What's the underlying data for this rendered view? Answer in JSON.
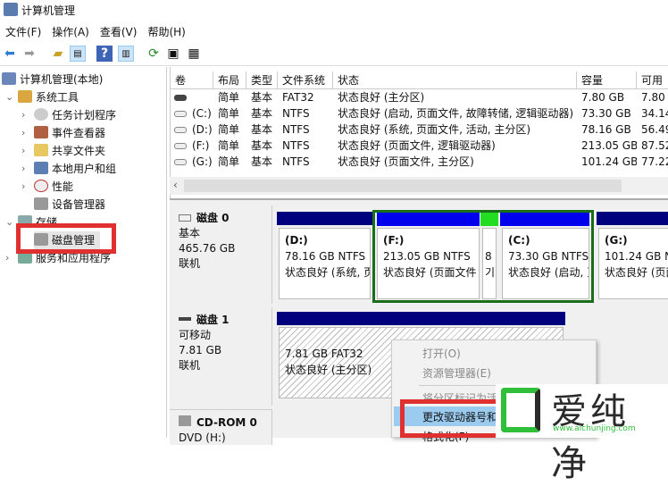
{
  "window": {
    "title": "计算机管理"
  },
  "menu": [
    "文件(F)",
    "操作(A)",
    "查看(V)",
    "帮助(H)"
  ],
  "toolbar": [
    "back-icon",
    "forward-icon",
    "up-folder-icon",
    "show-tree-icon",
    "help-icon",
    "show-action-icon",
    "refresh-icon",
    "properties-icon",
    "export-icon"
  ],
  "tree": {
    "root": "计算机管理(本地)",
    "system_tools": "系统工具",
    "items": [
      "任务计划程序",
      "事件查看器",
      "共享文件夹",
      "本地用户和组",
      "性能",
      "设备管理器"
    ],
    "storage": "存储",
    "disk_mgmt": "磁盘管理",
    "services": "服务和应用程序"
  },
  "table": {
    "headers": [
      "卷",
      "布局",
      "类型",
      "文件系统",
      "状态",
      "容量",
      "可用"
    ],
    "rows": [
      [
        "",
        "简单",
        "基本",
        "FAT32",
        "状态良好 (主分区)",
        "7.80 GB",
        "7.80"
      ],
      [
        "(C:)",
        "简单",
        "基本",
        "NTFS",
        "状态良好 (启动, 页面文件, 故障转储, 逻辑驱动器)",
        "73.30 GB",
        "34.14"
      ],
      [
        "(D:)",
        "简单",
        "基本",
        "NTFS",
        "状态良好 (系统, 页面文件, 活动, 主分区)",
        "78.16 GB",
        "56.49"
      ],
      [
        "(F:)",
        "简单",
        "基本",
        "NTFS",
        "状态良好 (页面文件, 逻辑驱动器)",
        "213.05 GB",
        "87.52"
      ],
      [
        "(G:)",
        "简单",
        "基本",
        "NTFS",
        "状态良好 (页面文件, 主分区)",
        "101.24 GB",
        "77.22"
      ]
    ]
  },
  "disk0": {
    "name": "磁盘 0",
    "type": "基本",
    "size": "465.76 GB",
    "state": "联机",
    "parts": [
      {
        "letter": "(D:)",
        "size": "78.16 GB NTFS",
        "status": "状态良好 (系统, 页"
      },
      {
        "letter": "(F:)",
        "size": "213.05 GB NTFS",
        "status": "状态良好 (页面文件"
      },
      {
        "letter": "",
        "size": "8",
        "status": "기"
      },
      {
        "letter": "(C:)",
        "size": "73.30 GB NTFS",
        "status": "状态良好 (启动, 页"
      },
      {
        "letter": "(G:)",
        "size": "101.24 GB N",
        "status": "状态良好 (页面"
      }
    ]
  },
  "disk1": {
    "name": "磁盘 1",
    "type": "可移动",
    "size": "7.81 GB",
    "state": "联机",
    "part": {
      "size": "7.81 GB FAT32",
      "status": "状态良好 (主分区)"
    }
  },
  "cdrom": {
    "name": "CD-ROM 0",
    "type": "DVD (H:)"
  },
  "context_menu": [
    "打开(O)",
    "资源管理器(E)",
    "将分区标记为活动",
    "更改驱动器号和路径",
    "格式化(F)"
  ],
  "watermark": {
    "text": "爱纯净",
    "url": "www.aichunjing.com"
  },
  "colors": {
    "primary": "#00007f",
    "logical": "#0000ee",
    "free": "#22dd22",
    "select_green": "#1a6e1a",
    "highlight_red": "#e03030"
  }
}
